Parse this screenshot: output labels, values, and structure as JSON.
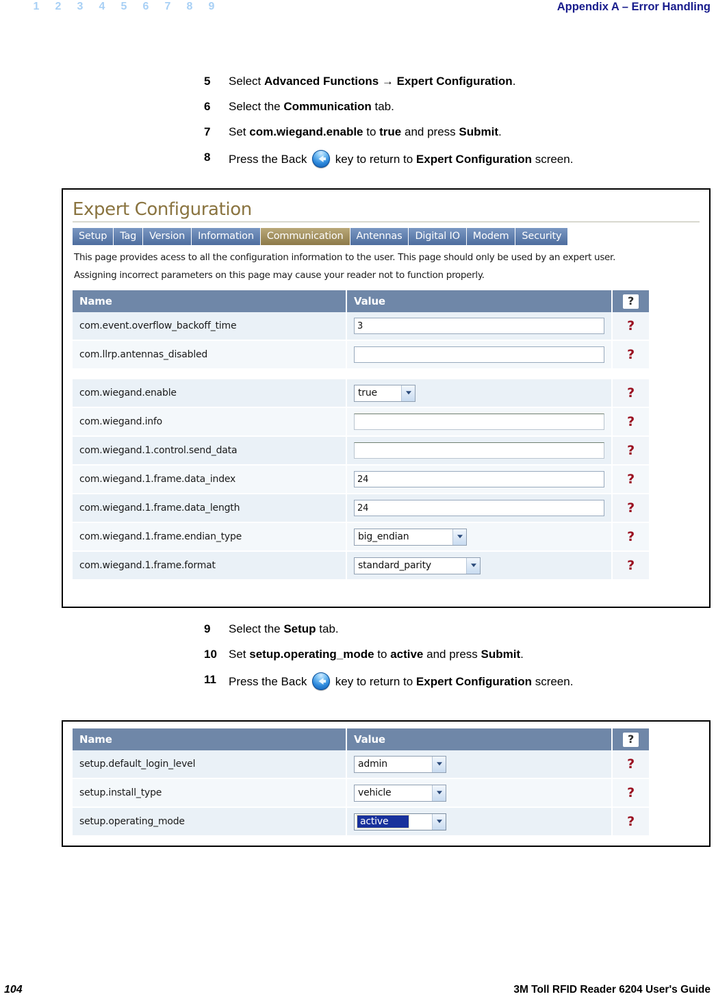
{
  "header": {
    "page_numbers": [
      "1",
      "2",
      "3",
      "4",
      "5",
      "6",
      "7",
      "8",
      "9"
    ],
    "title": "Appendix A – Error Handling"
  },
  "footer": {
    "page": "104",
    "guide": "3M Toll RFID Reader 6204 User's Guide"
  },
  "steps_group_a": [
    {
      "num": "5",
      "parts": [
        {
          "t": "Select ",
          "b": false
        },
        {
          "t": "Advanced Functions",
          "b": true
        },
        {
          "t": " → ",
          "b": false
        },
        {
          "t": "Expert Configuration",
          "b": true
        },
        {
          "t": ".",
          "b": false
        }
      ]
    },
    {
      "num": "6",
      "parts": [
        {
          "t": "Select the ",
          "b": false
        },
        {
          "t": "Communication",
          "b": true
        },
        {
          "t": " tab.",
          "b": false
        }
      ]
    },
    {
      "num": "7",
      "parts": [
        {
          "t": "Set ",
          "b": false
        },
        {
          "t": "com.wiegand.enable",
          "b": true
        },
        {
          "t": " to ",
          "b": false
        },
        {
          "t": "true",
          "b": true
        },
        {
          "t": " and press ",
          "b": false
        },
        {
          "t": "Submit",
          "b": true
        },
        {
          "t": ".",
          "b": false
        }
      ]
    },
    {
      "num": "8",
      "icon": "back-arrow-icon",
      "parts": [
        {
          "t": "Press the Back ",
          "b": false
        },
        {
          "t": "@icon",
          "b": false
        },
        {
          "t": " key to return to ",
          "b": false
        },
        {
          "t": "Expert Configuration",
          "b": true
        },
        {
          "t": " screen.",
          "b": false
        }
      ]
    }
  ],
  "steps_group_b": [
    {
      "num": "9",
      "parts": [
        {
          "t": "Select the ",
          "b": false
        },
        {
          "t": "Setup",
          "b": true
        },
        {
          "t": " tab.",
          "b": false
        }
      ]
    },
    {
      "num": "10",
      "parts": [
        {
          "t": "Set ",
          "b": false
        },
        {
          "t": "setup.operating_mode",
          "b": true
        },
        {
          "t": " to ",
          "b": false
        },
        {
          "t": "active",
          "b": true
        },
        {
          "t": " and press ",
          "b": false
        },
        {
          "t": "Submit",
          "b": true
        },
        {
          "t": ".",
          "b": false
        }
      ]
    },
    {
      "num": "11",
      "icon": "back-arrow-icon",
      "parts": [
        {
          "t": "Press the Back ",
          "b": false
        },
        {
          "t": "@icon",
          "b": false
        },
        {
          "t": " key to return to ",
          "b": false
        },
        {
          "t": "Expert Configuration",
          "b": true
        },
        {
          "t": " screen.",
          "b": false
        }
      ]
    }
  ],
  "screenshot_communication": {
    "title": "Expert Configuration",
    "tabs": [
      {
        "label": "Setup",
        "active": false
      },
      {
        "label": "Tag",
        "active": false
      },
      {
        "label": "Version",
        "active": false
      },
      {
        "label": "Information",
        "active": false
      },
      {
        "label": "Communication",
        "active": true
      },
      {
        "label": "Antennas",
        "active": false
      },
      {
        "label": "Digital IO",
        "active": false
      },
      {
        "label": "Modem",
        "active": false
      },
      {
        "label": "Security",
        "active": false
      }
    ],
    "description_line_1": "This page provides acess to all the configuration information to the user. This page should only be used by an expert user.",
    "description_line_2": "Assigning incorrect parameters on this page may cause your reader not to function properly.",
    "table": {
      "columns": [
        "Name",
        "Value",
        "?"
      ],
      "help_glyph": "?",
      "rows": [
        {
          "name": "com.event.overflow_backoff_time",
          "kind": "text",
          "value": "3",
          "help": "?"
        },
        {
          "name": "com.llrp.antennas_disabled",
          "kind": "text",
          "value": "",
          "help": "?"
        },
        {
          "spacer": true
        },
        {
          "name": "com.wiegand.enable",
          "kind": "select",
          "value": "true",
          "width": "w-sm",
          "help": "?"
        },
        {
          "name": "com.wiegand.info",
          "kind": "text-underline",
          "value": "",
          "help": "?"
        },
        {
          "name": "com.wiegand.1.control.send_data",
          "kind": "text-underline",
          "value": "",
          "help": "?"
        },
        {
          "name": "com.wiegand.1.frame.data_index",
          "kind": "text",
          "value": "24",
          "help": "?"
        },
        {
          "name": "com.wiegand.1.frame.data_length",
          "kind": "text",
          "value": "24",
          "help": "?"
        },
        {
          "name": "com.wiegand.1.frame.endian_type",
          "kind": "select",
          "value": "big_endian",
          "width": "w-lg",
          "help": "?"
        },
        {
          "name": "com.wiegand.1.frame.format",
          "kind": "select",
          "value": "standard_parity",
          "width": "w-xl",
          "help": "?"
        }
      ]
    }
  },
  "screenshot_setup": {
    "table": {
      "columns": [
        "Name",
        "Value",
        "?"
      ],
      "help_glyph": "?",
      "rows": [
        {
          "name": "setup.default_login_level",
          "kind": "select",
          "value": "admin",
          "width": "w-md",
          "help": "?"
        },
        {
          "name": "setup.install_type",
          "kind": "select",
          "value": "vehicle",
          "width": "w-md",
          "help": "?"
        },
        {
          "name": "setup.operating_mode",
          "kind": "select",
          "value": "active",
          "width": "w-md",
          "selected": true,
          "help": "?"
        }
      ]
    }
  },
  "colors": {
    "header_title": "#181c8c",
    "page_number": "#a8d0f5",
    "shot_title": "#8a7440",
    "tab": "#4d6d9e",
    "tab_active": "#8d7a49",
    "table_header": "#6f87a8",
    "row_bg": "#eaf1f7",
    "help_mark": "#9a1020",
    "selected_bg": "#18319c"
  }
}
